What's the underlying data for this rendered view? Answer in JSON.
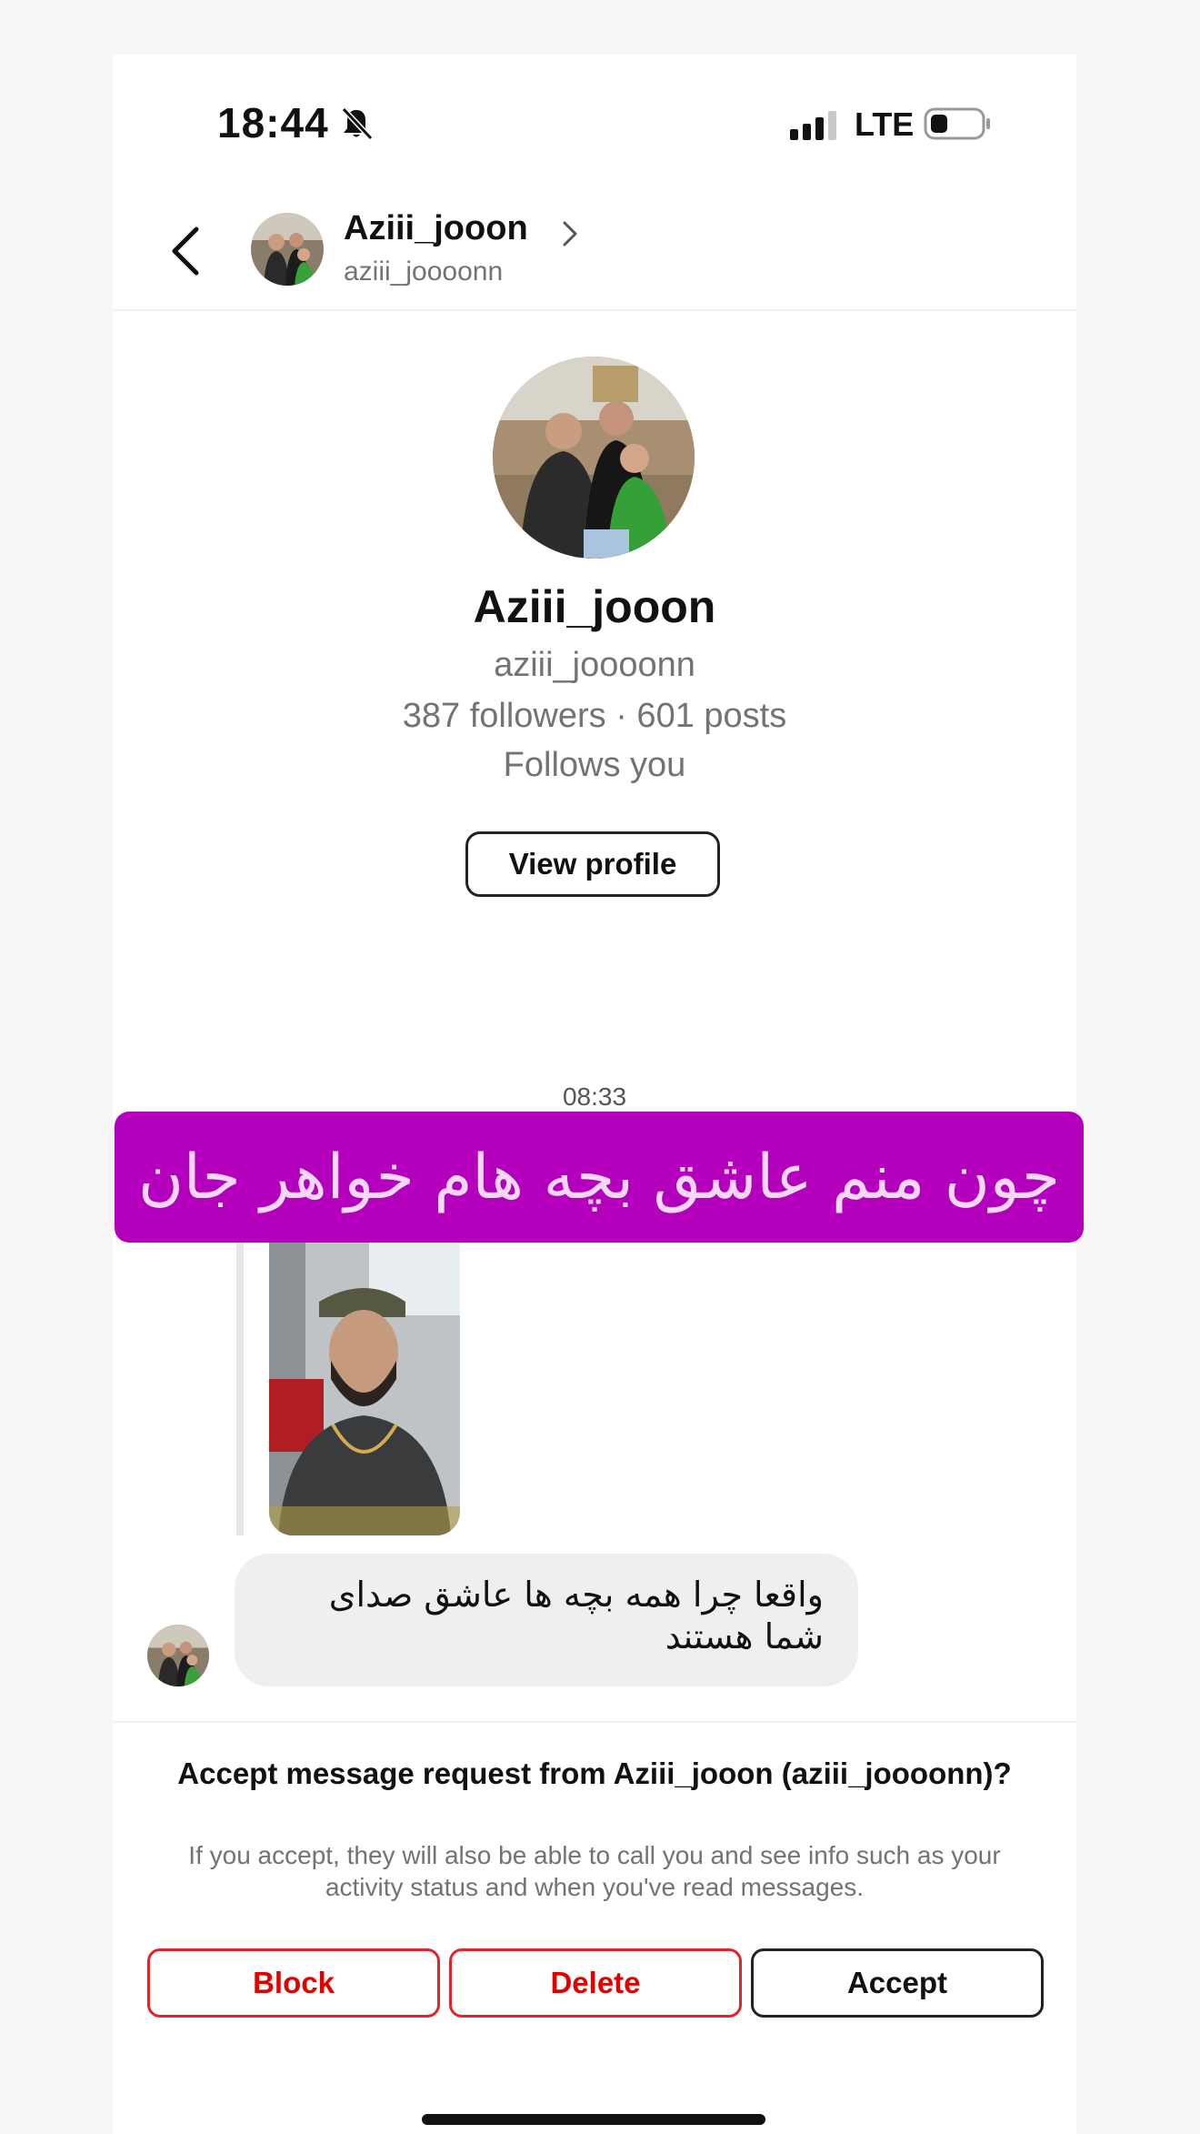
{
  "status_bar": {
    "time": "18:44",
    "network": "LTE",
    "icons": [
      "bell-slash-icon",
      "signal-icon",
      "battery-icon"
    ]
  },
  "header": {
    "display_name": "Aziii_jooon",
    "username": "aziii_joooonn",
    "icons": [
      "back-icon",
      "chevron-right-icon"
    ]
  },
  "profile": {
    "display_name": "Aziii_jooon",
    "username": "aziii_joooonn",
    "stats": "387 followers · 601 posts",
    "follows_you": "Follows you",
    "view_profile_label": "View profile"
  },
  "conversation": {
    "timestamp": "08:33",
    "caption_overlay": "چون منم عاشق بچه هام خواهر جان",
    "message_text": "واقعا چرا همه بچه ها عاشق صدای شما هستند"
  },
  "request": {
    "title": "Accept message request from Aziii_jooon (aziii_joooonn)?",
    "description": "If you accept, they will also be able to call you and see info such as your activity status and when you've read messages.",
    "block_label": "Block",
    "delete_label": "Delete",
    "accept_label": "Accept"
  },
  "colors": {
    "caption_banner": "#b400bd",
    "destructive": "#e00000",
    "secondary_text": "#737373",
    "bubble": "#efefef"
  }
}
